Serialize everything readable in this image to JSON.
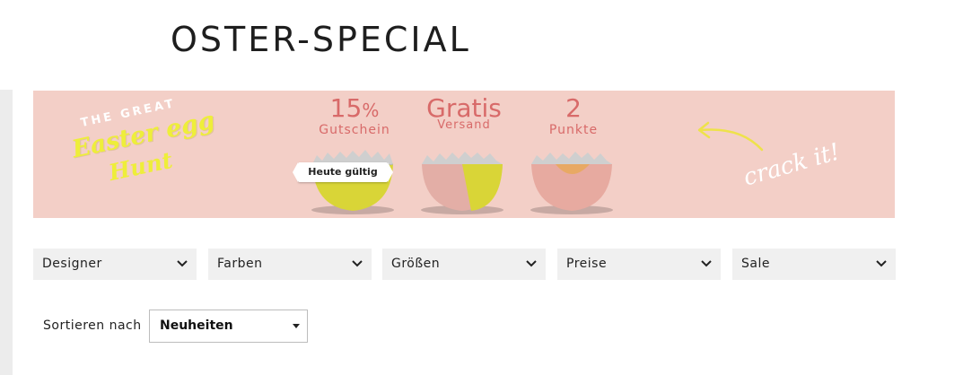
{
  "page": {
    "title": "OSTER-SPECIAL"
  },
  "banner": {
    "logo": {
      "line1": "THE GREAT",
      "line2": "Easter egg",
      "line3": "Hunt"
    },
    "eggs": [
      {
        "big": "15",
        "big_suffix": "%",
        "small": "Gutschein",
        "badge": "Heute gültig",
        "fill": "yellow"
      },
      {
        "big": "Gratis",
        "small": "Versand",
        "fill": "pink-yellow"
      },
      {
        "big": "2",
        "small": "Punkte",
        "fill": "pink-orange"
      }
    ],
    "cta": "crack it!",
    "colors": {
      "background": "#f3cfc7",
      "headline": "#d86a69",
      "yellow": "#d9d537",
      "pink": "#e7aaa0",
      "orange": "#e8a964"
    }
  },
  "filters": [
    {
      "label": "Designer",
      "icon": "chevron-down-icon"
    },
    {
      "label": "Farben",
      "icon": "chevron-down-icon"
    },
    {
      "label": "Größen",
      "icon": "chevron-down-icon"
    },
    {
      "label": "Preise",
      "icon": "chevron-down-icon"
    },
    {
      "label": "Sale",
      "icon": "chevron-down-icon"
    }
  ],
  "sort": {
    "label": "Sortieren nach",
    "selected": "Neuheiten"
  }
}
